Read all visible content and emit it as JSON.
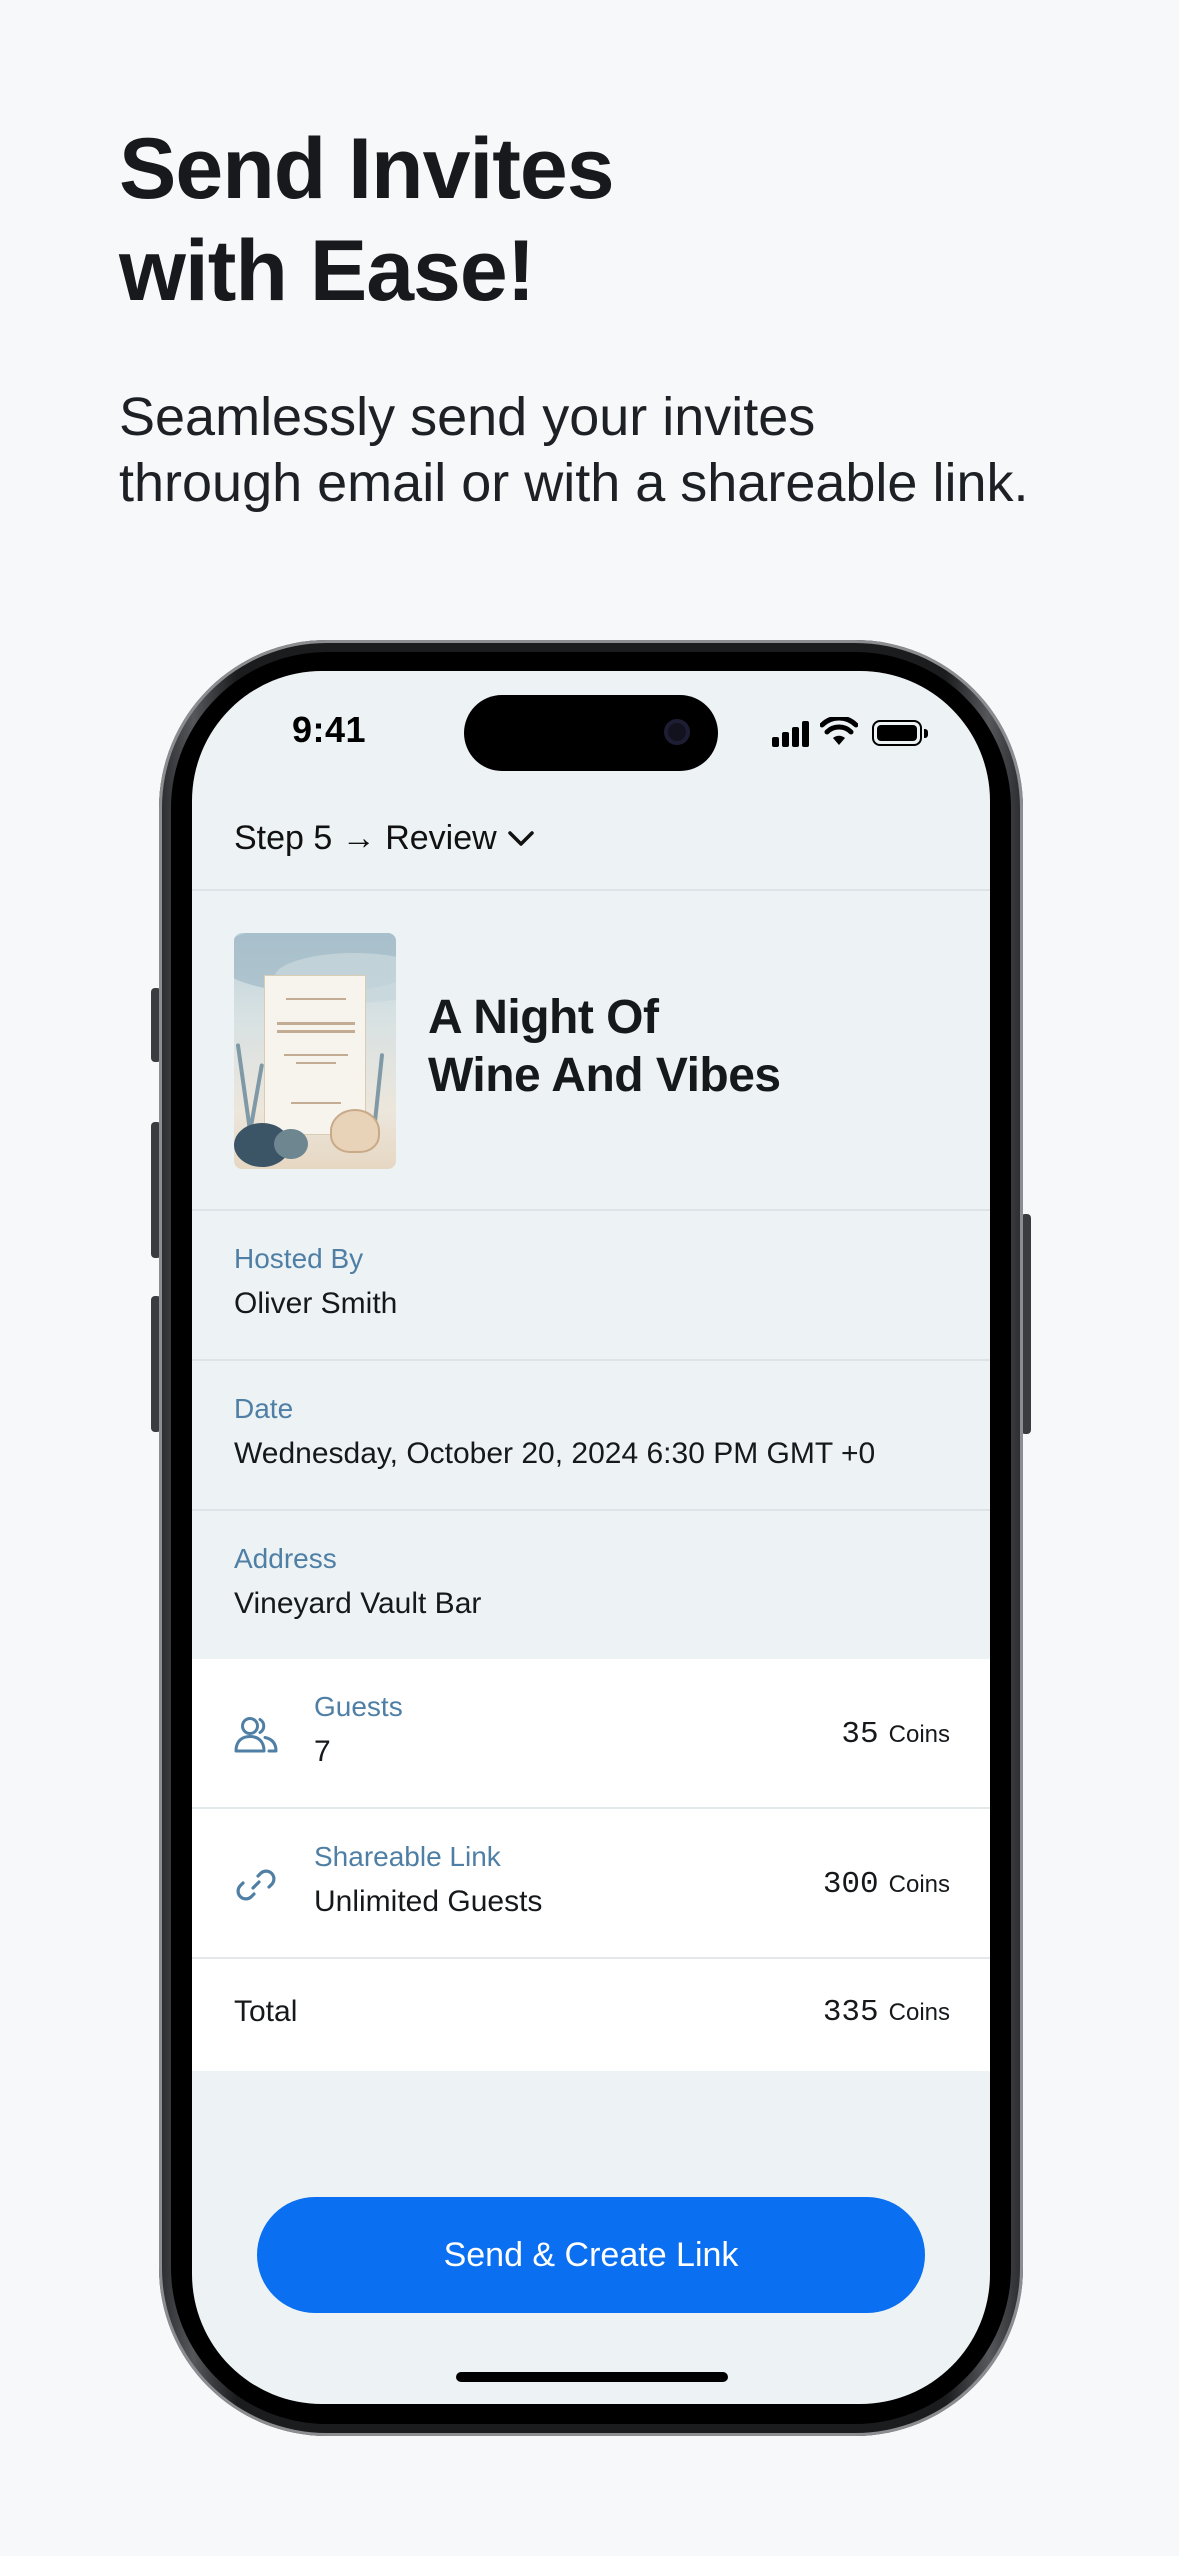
{
  "hero": {
    "title": "Send Invites\nwith Ease!",
    "subtitle": "Seamlessly send your invites\nthrough email or with a shareable link."
  },
  "status_bar": {
    "time": "9:41",
    "icons": [
      "cellular-signal-icon",
      "wifi-icon",
      "battery-icon"
    ]
  },
  "header": {
    "step_label": "Step 5 → Review",
    "dropdown_icon": "chevron-down-icon"
  },
  "event": {
    "title": "A Night Of\nWine And Vibes",
    "thumbnail": "invitation-card-watercolor-ocean"
  },
  "details": [
    {
      "label": "Hosted By",
      "value": "Oliver Smith"
    },
    {
      "label": "Date",
      "value": "Wednesday, October 20, 2024 6:30 PM GMT +0"
    },
    {
      "label": "Address",
      "value": "Vineyard Vault Bar"
    }
  ],
  "pricing": {
    "items": [
      {
        "icon": "users-icon",
        "label": "Guests",
        "value": "7",
        "coins": "35",
        "unit": "Coins"
      },
      {
        "icon": "link-icon",
        "label": "Shareable Link",
        "value": "Unlimited Guests",
        "coins": "300",
        "unit": "Coins"
      }
    ],
    "total": {
      "label": "Total",
      "coins": "335",
      "unit": "Coins"
    }
  },
  "cta": {
    "label": "Send & Create Link"
  },
  "colors": {
    "accent": "#0a6ff0",
    "label_blue": "#4f7fa5",
    "screen_bg": "#edf2f4",
    "page_bg": "#f6f8fa"
  }
}
